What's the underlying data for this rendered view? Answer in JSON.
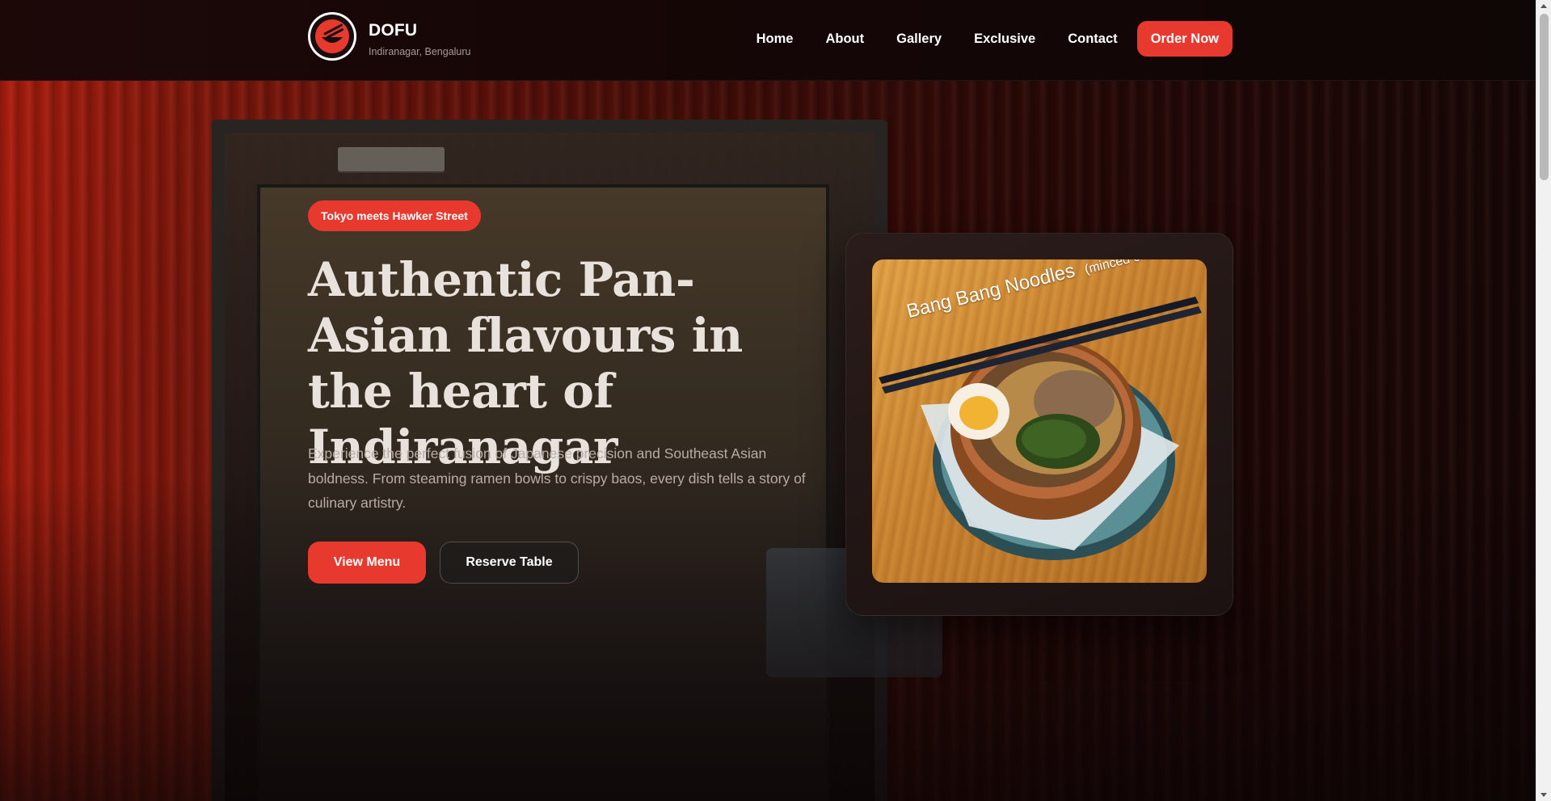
{
  "header": {
    "brand_name": "DOFU",
    "brand_location": "Indiranagar, Bengaluru",
    "logo_icon": "chopsticks-bowl-logo-icon",
    "nav": [
      {
        "label": "Home"
      },
      {
        "label": "About"
      },
      {
        "label": "Gallery"
      },
      {
        "label": "Exclusive"
      },
      {
        "label": "Contact"
      }
    ],
    "cta_label": "Order Now"
  },
  "hero": {
    "tag": "Tokyo meets Hawker Street",
    "headline": "Authentic Pan-Asian flavours in the heart of Indiranagar",
    "description": "Experience the perfect fusion of Japanese precision and Southeast Asian boldness. From steaming ramen bowls to crispy baos, every dish tells a story of culinary artistry.",
    "primary_button": "View Menu",
    "secondary_button": "Reserve Table"
  },
  "dish": {
    "caption_main": "Bang Bang Noodles",
    "caption_sub": "(minced chicken)"
  },
  "colors": {
    "accent": "#e8392f",
    "background": "#0d0606",
    "header_bg": "#150606",
    "text_primary": "#ffffff",
    "text_muted": "#b9aca6"
  }
}
